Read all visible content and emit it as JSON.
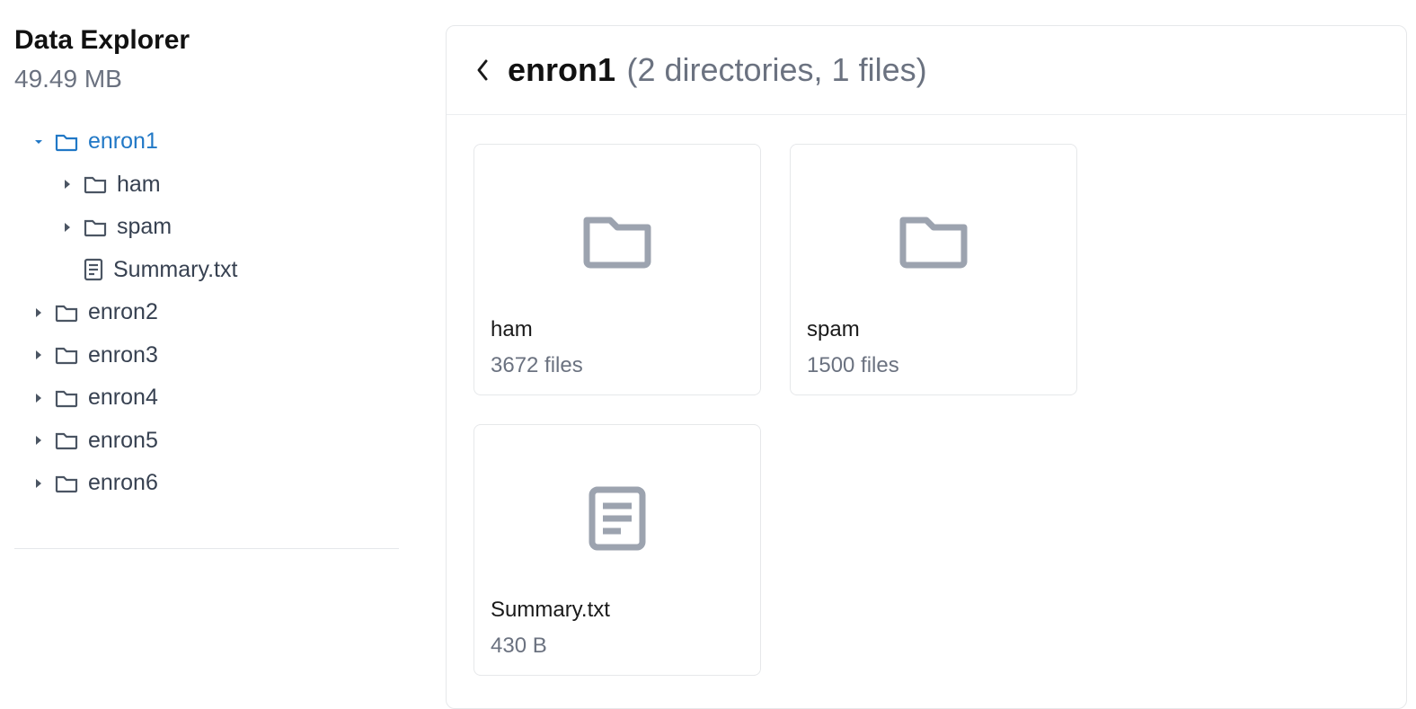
{
  "sidebar": {
    "title": "Data Explorer",
    "size": "49.49 MB",
    "tree": {
      "enron1": {
        "label": "enron1"
      },
      "ham": {
        "label": "ham"
      },
      "spam": {
        "label": "spam"
      },
      "summary": {
        "label": "Summary.txt"
      },
      "enron2": {
        "label": "enron2"
      },
      "enron3": {
        "label": "enron3"
      },
      "enron4": {
        "label": "enron4"
      },
      "enron5": {
        "label": "enron5"
      },
      "enron6": {
        "label": "enron6"
      }
    }
  },
  "main": {
    "folder_name": "enron1",
    "folder_meta": "(2 directories, 1 files)",
    "items": [
      {
        "name": "ham",
        "meta": "3672 files"
      },
      {
        "name": "spam",
        "meta": "1500 files"
      },
      {
        "name": "Summary.txt",
        "meta": "430 B"
      }
    ]
  },
  "colors": {
    "accent": "#2178c6",
    "muted": "#6b7280",
    "icon_gray": "#9ca3af",
    "border": "#e6e8ea"
  }
}
